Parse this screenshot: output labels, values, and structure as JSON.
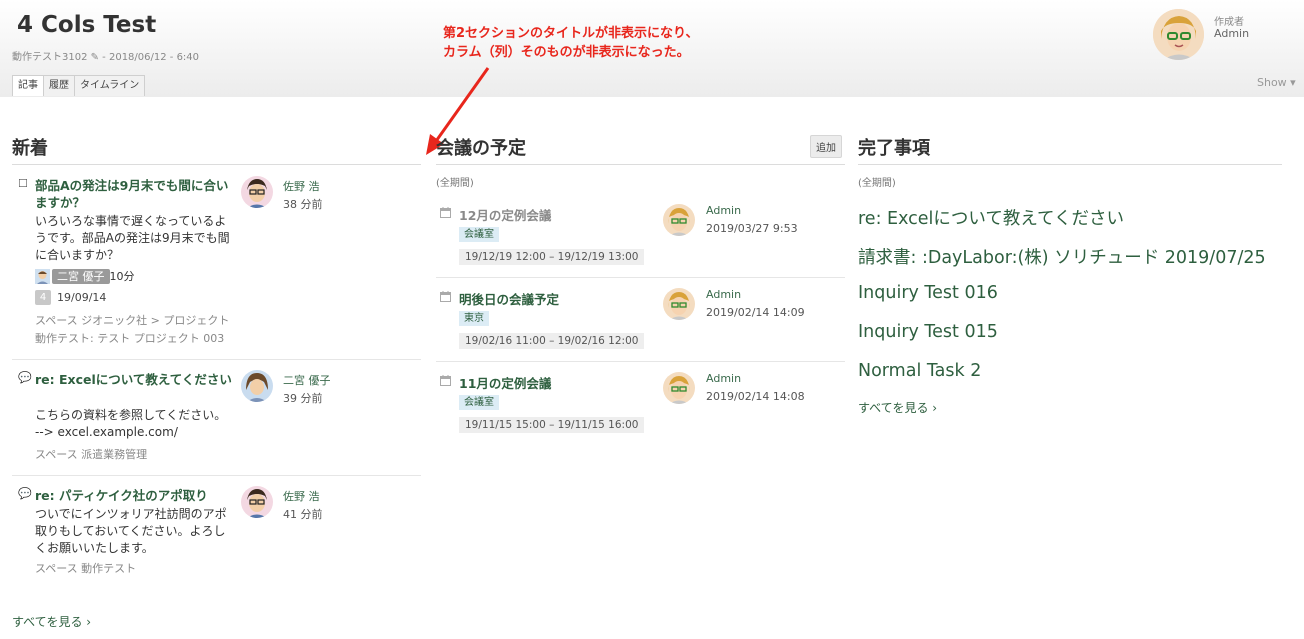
{
  "header": {
    "title": "4 Cols Test",
    "meta": "動作テスト3102 ✎ - 2018/06/12 - 6:40",
    "tabs": [
      "記事",
      "履歴",
      "タイムライン"
    ],
    "author_label": "作成者",
    "author_name": "Admin",
    "show_label": "Show ▾"
  },
  "annotation": {
    "line1": "第2セクションのタイトルが非表示になり、",
    "line2": "カラム（列）そのものが非表示になった。",
    "color": "#e8261c"
  },
  "col1": {
    "title": "新着",
    "posts": [
      {
        "icon": "checkbox-icon",
        "title": "部品Aの発注は9月末でも間に合いますか？",
        "body": "いろいろな事情で遅くなっているようです。部品Aの発注は9月末でも間に合いますか？",
        "user": "佐野 浩",
        "time": "38 分前",
        "assignee": "二宮 優子",
        "assignee_suffix": "10分",
        "count": "4",
        "due": "19/09/14",
        "place1": "スペース ジオニック社 > プロジェクト",
        "place2": "動作テスト: テスト プロジェクト 003"
      },
      {
        "icon": "comment-icon",
        "title": "re: Excelについて教えてください",
        "body1": "こちらの資料を参照してください。",
        "body2": "--> excel.example.com/",
        "user": "二宮 優子",
        "time": "39 分前",
        "place": "スペース 派遣業務管理"
      },
      {
        "icon": "comment-icon",
        "title": "re: パティケイク社のアポ取り",
        "body": "ついでにインツォリア社訪問のアポ取りもしておいてください。よろしくお願いいたします。",
        "user": "佐野 浩",
        "time": "41 分前",
        "place": "スペース 動作テスト"
      }
    ],
    "see_all": "すべてを見る ›"
  },
  "col2": {
    "title": "会議の予定",
    "add_label": "追加",
    "period": "(全期間)",
    "events": [
      {
        "title": "12月の定例会議",
        "place": "会議室",
        "range": "19/12/19 12:00 – 19/12/19 13:00",
        "user": "Admin",
        "date": "2019/03/27 9:53"
      },
      {
        "title": "明後日の会議予定",
        "place": "東京",
        "range": "19/02/16 11:00 – 19/02/16 12:00",
        "user": "Admin",
        "date": "2019/02/14 14:09"
      },
      {
        "title": "11月の定例会議",
        "place": "会議室",
        "range": "19/11/15 15:00 – 19/11/15 16:00",
        "user": "Admin",
        "date": "2019/02/14 14:08"
      }
    ]
  },
  "col3": {
    "title": "完了事項",
    "period": "(全期間)",
    "items": [
      "re: Excelについて教えてください",
      "請求書: :DayLabor:(株) ソリチュード 2019/07/25",
      "Inquiry Test 016",
      "Inquiry Test 015",
      "Normal Task 2"
    ],
    "see_all": "すべてを見る ›"
  },
  "colors": {
    "link_green": "#2e5f3f",
    "place_tag_bg": "#dcecf5"
  }
}
